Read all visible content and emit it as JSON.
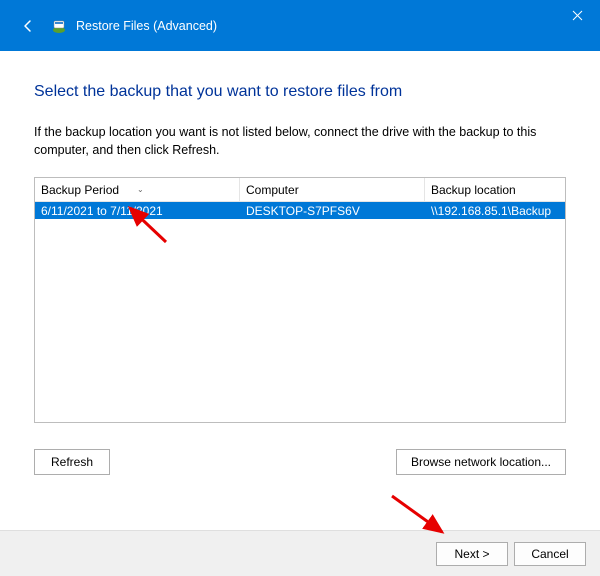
{
  "window": {
    "title": "Restore Files (Advanced)"
  },
  "heading": "Select the backup that you want to restore files from",
  "description": "If the backup location you want is not listed below, connect the drive with the backup to this computer, and then click Refresh.",
  "columns": {
    "period": "Backup Period",
    "computer": "Computer",
    "location": "Backup location"
  },
  "rows": [
    {
      "period": "6/11/2021 to 7/11/2021",
      "computer": "DESKTOP-S7PFS6V",
      "location": "\\\\192.168.85.1\\Backup"
    }
  ],
  "buttons": {
    "refresh": "Refresh",
    "browse": "Browse network location...",
    "next": "Next >",
    "cancel": "Cancel"
  }
}
